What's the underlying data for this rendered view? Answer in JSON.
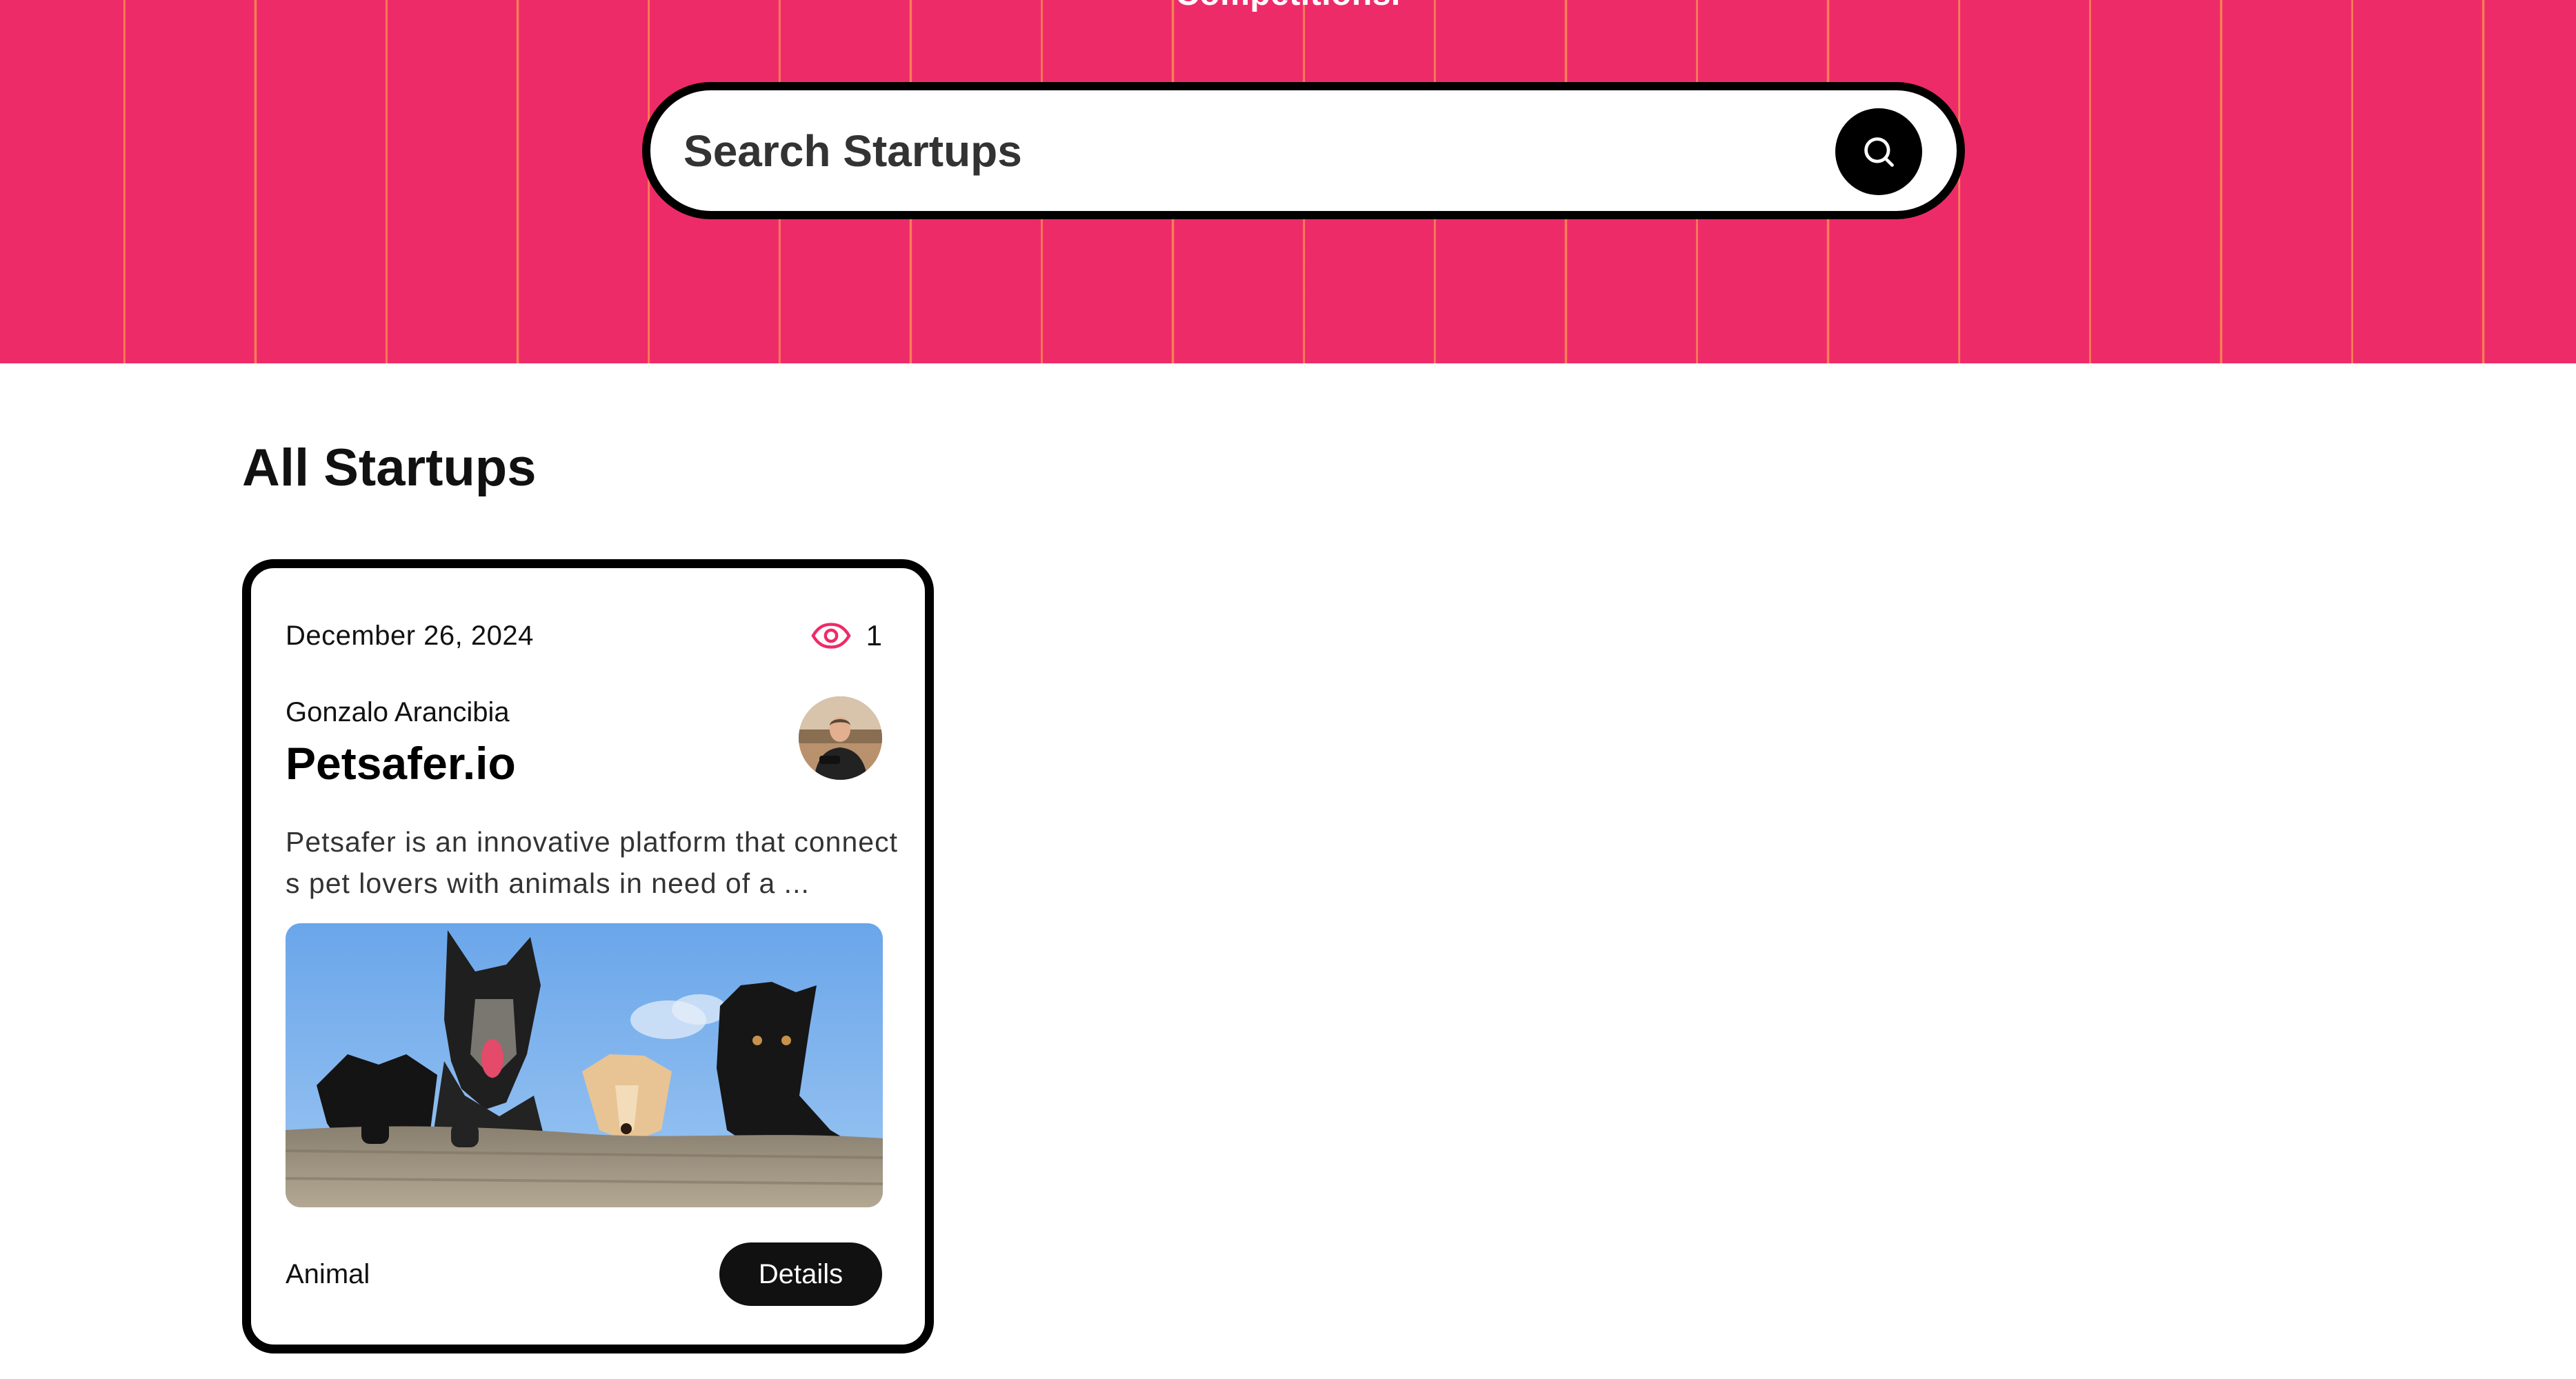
{
  "colors": {
    "hero_background": "#ee2b69",
    "hero_stripes": "#ffc446",
    "accent": "#ee2b69",
    "button_dark": "#111111"
  },
  "hero": {
    "subtitle": "Competitions."
  },
  "search": {
    "placeholder": "Search Startups",
    "button_icon": "search-icon"
  },
  "section": {
    "title": "All Startups"
  },
  "startups": [
    {
      "date": "December 26, 2024",
      "views": "1",
      "views_icon": "eye-icon",
      "author": "Gonzalo Arancibia",
      "title": "Petsafer.io",
      "description": "Petsafer is an innovative platform that connects pet lovers with animals in need of a ...",
      "category": "Animal",
      "details_label": "Details"
    }
  ]
}
